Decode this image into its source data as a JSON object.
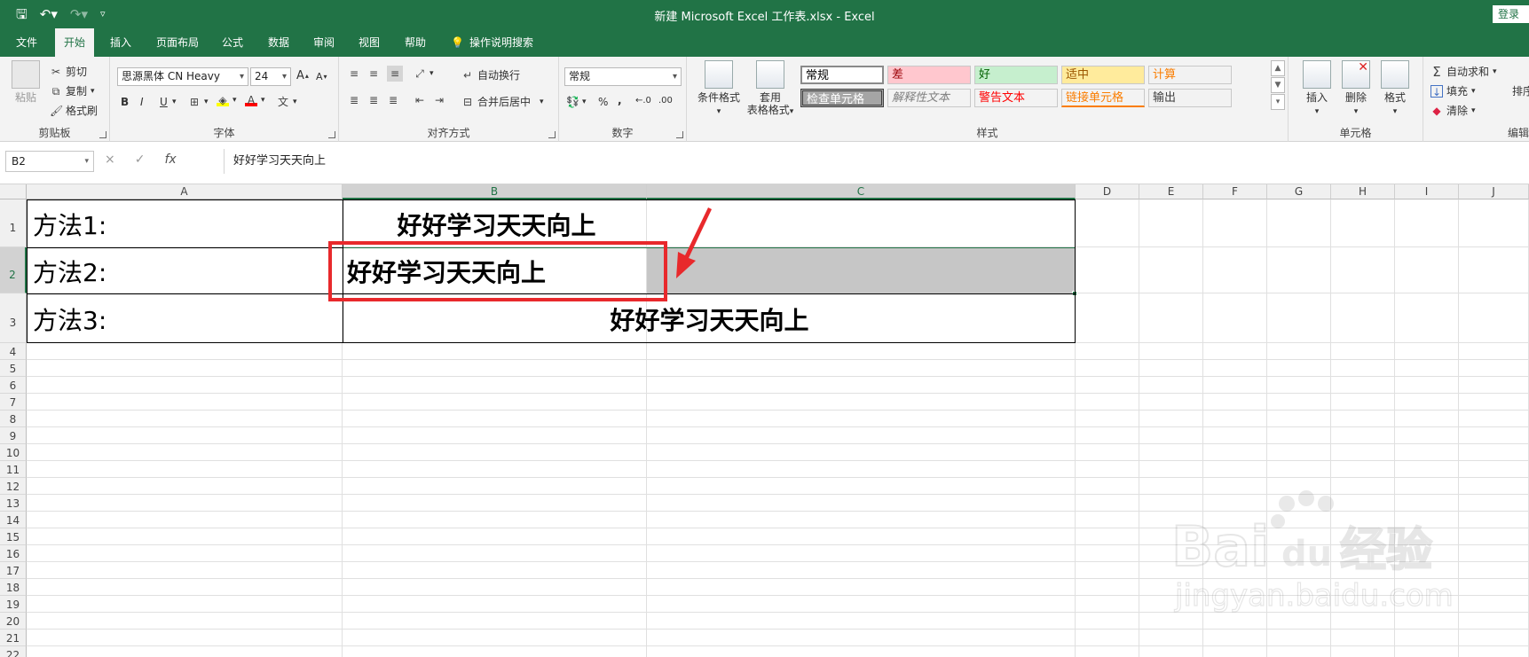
{
  "window": {
    "title": "新建 Microsoft Excel 工作表.xlsx  -  Excel",
    "login_label": "登录"
  },
  "tabs": [
    "文件",
    "开始",
    "插入",
    "页面布局",
    "公式",
    "数据",
    "审阅",
    "视图",
    "帮助"
  ],
  "tell_me": "操作说明搜索",
  "clipboard": {
    "paste": "粘贴",
    "cut": "剪切",
    "copy": "复制",
    "painter": "格式刷",
    "label": "剪贴板"
  },
  "font": {
    "name": "思源黑体 CN Heavy",
    "size": "24",
    "label": "字体",
    "grow": "A",
    "shrink": "A",
    "bold": "B",
    "italic": "I",
    "underline": "U"
  },
  "alignment": {
    "wrap": "自动换行",
    "merge": "合并后居中",
    "label": "对齐方式"
  },
  "number": {
    "format": "常规",
    "label": "数字",
    "percent": "%",
    "comma": ",",
    "inc": "←.0",
    "dec": ".00"
  },
  "styles": {
    "conditional": "条件格式",
    "table": [
      "套用",
      "表格格式"
    ],
    "cells": [
      {
        "text": "常规",
        "bg": "#ffffff",
        "fg": "#000000"
      },
      {
        "text": "差",
        "bg": "#ffc7ce",
        "fg": "#9c0006"
      },
      {
        "text": "好",
        "bg": "#c6efce",
        "fg": "#006100"
      },
      {
        "text": "适中",
        "bg": "#ffeb9c",
        "fg": "#9c5700"
      },
      {
        "text": "计算",
        "bg": "#f2f2f2",
        "fg": "#fa7d00"
      },
      {
        "text": "检查单元格",
        "bg": "#a5a5a5",
        "fg": "#ffffff"
      },
      {
        "text": "解释性文本",
        "bg": "#f3f3f3",
        "fg": "#7f7f7f"
      },
      {
        "text": "警告文本",
        "bg": "#f3f3f3",
        "fg": "#ff0000"
      },
      {
        "text": "链接单元格",
        "bg": "#f3f3f3",
        "fg": "#fa7d00"
      },
      {
        "text": "输出",
        "bg": "#f2f2f2",
        "fg": "#3f3f3f"
      }
    ],
    "label": "样式"
  },
  "cells_group": {
    "insert": "插入",
    "delete": "删除",
    "format": "格式",
    "label": "单元格"
  },
  "editing": {
    "autosum": "自动求和",
    "fill": "填充",
    "clear": "清除",
    "sort": "排序",
    "label": "编辑"
  },
  "formula_bar": {
    "name_box": "B2",
    "cancel": "×",
    "enter": "✓",
    "fx": "fx",
    "content": "好好学习天天向上"
  },
  "columns": [
    "A",
    "B",
    "C",
    "D",
    "E",
    "F",
    "G",
    "H",
    "I",
    "J"
  ],
  "rows": [
    "1",
    "2",
    "3",
    "4",
    "5",
    "6",
    "7",
    "8",
    "9",
    "10",
    "11",
    "12",
    "13",
    "14",
    "15",
    "16",
    "17",
    "18",
    "19",
    "20",
    "21",
    "22"
  ],
  "sheet_cells": {
    "a1": "方法1:",
    "b1": "好好学习天天向上",
    "a2": "方法2:",
    "b2": "好好学习天天向上",
    "a3": "方法3:",
    "bc3": "好好学习天天向上"
  },
  "watermark": {
    "brand": "Bai",
    "du": "du",
    "cn": "经验",
    "url": "jingyan.baidu.com"
  },
  "colors": {
    "excel_green": "#217346",
    "highlight_red": "#e8292c",
    "selected_fill": "#c6c6c6"
  }
}
